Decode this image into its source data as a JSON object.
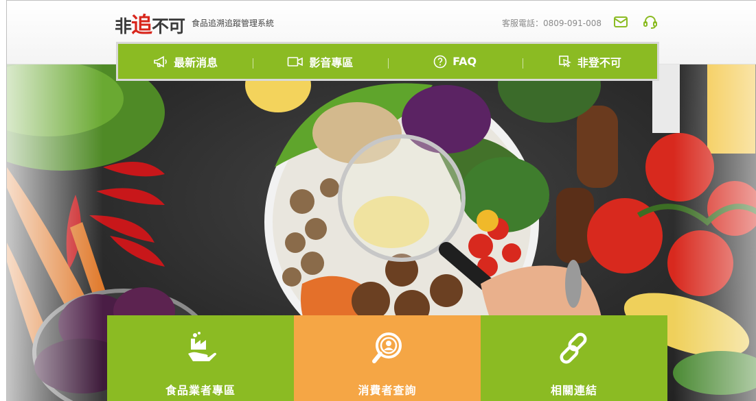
{
  "header": {
    "logo": {
      "part1": "非",
      "part2": "追",
      "part3": "不可"
    },
    "system_name": "食品追溯追蹤管理系統",
    "hotline": "客服電話：0809-091-008",
    "icons": [
      "mail-icon",
      "headset-icon"
    ]
  },
  "nav": {
    "items": [
      {
        "label": "最新消息",
        "icon": "megaphone-icon"
      },
      {
        "label": "影音專區",
        "icon": "video-camera-icon"
      },
      {
        "label": "FAQ",
        "icon": "question-icon"
      },
      {
        "label": "非登不可",
        "icon": "login-pointer-icon"
      }
    ]
  },
  "tiles": [
    {
      "label": "食品業者專區",
      "icon": "factory-hand-icon",
      "color": "#8bbb23"
    },
    {
      "label": "消費者查詢",
      "icon": "magnifier-user-icon",
      "color": "#f5a645"
    },
    {
      "label": "相關連結",
      "icon": "link-icon",
      "color": "#8bbb23"
    }
  ],
  "colors": {
    "brand_green": "#8bbb23",
    "accent_orange": "#f5a645",
    "logo_red": "#d8261c"
  }
}
